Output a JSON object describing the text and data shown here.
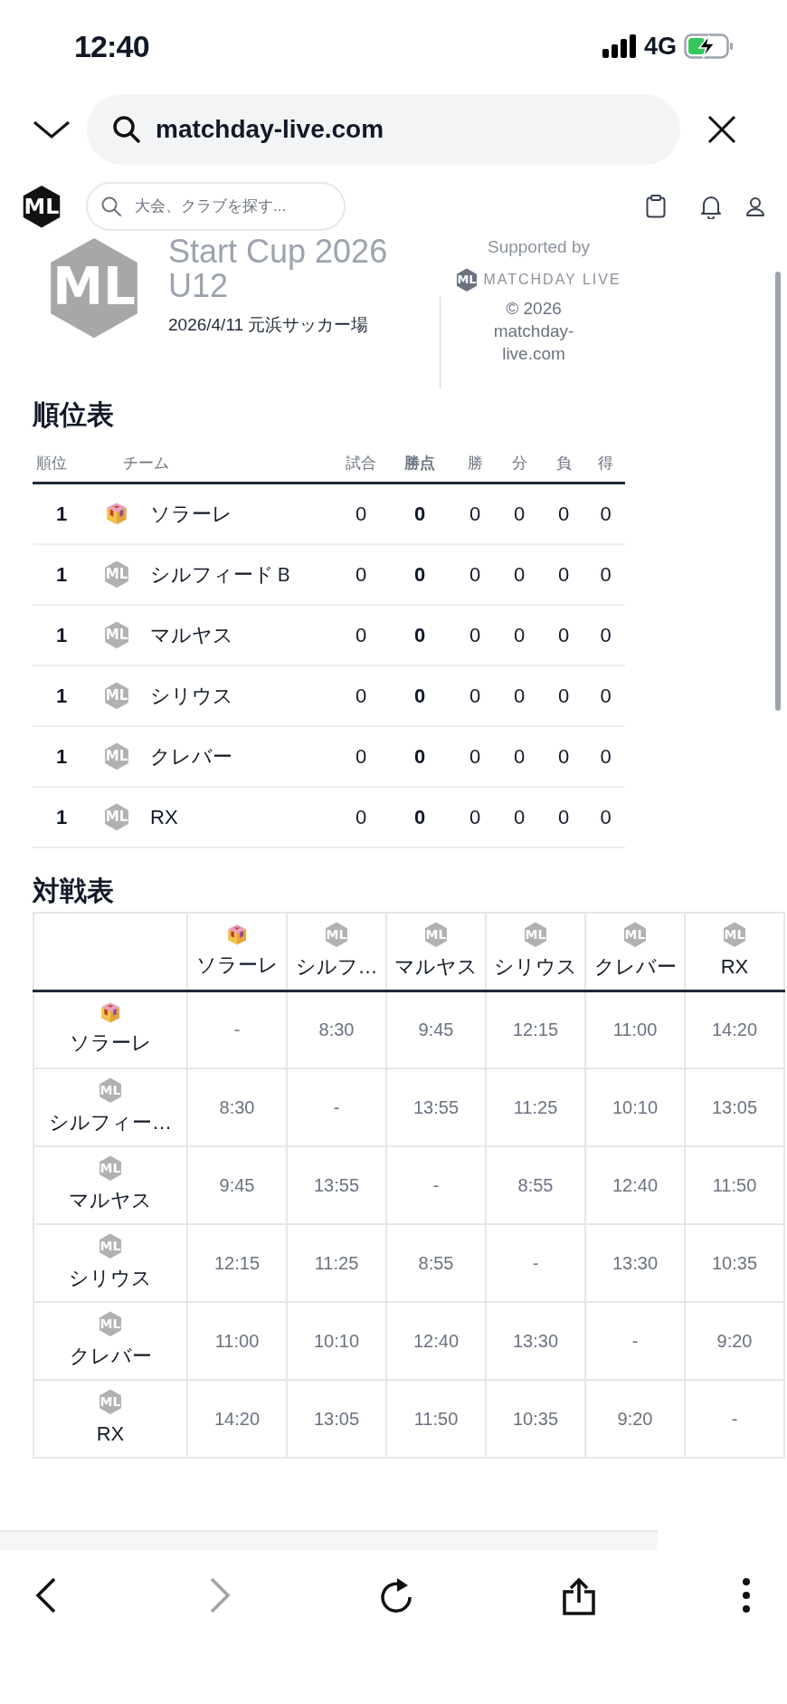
{
  "status_bar": {
    "time": "12:40",
    "network": "4G"
  },
  "browser": {
    "url": "matchday-live.com",
    "back": {
      "disabled": false
    },
    "forward": {
      "disabled": true
    }
  },
  "site_header": {
    "logo_text": "ML",
    "search_placeholder": "大会、クラブを探す..."
  },
  "tournament": {
    "logo_text": "ML",
    "title_lines": [
      "Start Cup 2026",
      "U12"
    ],
    "details": "2026/4/11 元浜サッカー場"
  },
  "sponsor": {
    "label": "Supported by",
    "brand": "MATCHDAY LIVE",
    "brand_logo_text": "ML",
    "copyright_lines": [
      "© 2026",
      "matchday-",
      "live.com"
    ]
  },
  "standings": {
    "title": "順位表",
    "columns": [
      {
        "label": "順位",
        "kind": "rank"
      },
      {
        "label": "チーム",
        "kind": "team"
      },
      {
        "label": "試合",
        "kind": "stat"
      },
      {
        "label": "勝点",
        "kind": "points"
      },
      {
        "label": "勝",
        "kind": "stat"
      },
      {
        "label": "分",
        "kind": "stat"
      },
      {
        "label": "負",
        "kind": "stat"
      },
      {
        "label": "得",
        "kind": "stat"
      }
    ],
    "rows": [
      {
        "rank": "1",
        "team": {
          "name": "ソラーレ",
          "crest": {
            "kind": "cube"
          }
        },
        "stats": [
          "0",
          "0",
          "0",
          "0",
          "0",
          "0"
        ]
      },
      {
        "rank": "1",
        "team": {
          "name": "シルフィードＢ",
          "crest": {
            "kind": "monogram",
            "text": "ML"
          }
        },
        "stats": [
          "0",
          "0",
          "0",
          "0",
          "0",
          "0"
        ]
      },
      {
        "rank": "1",
        "team": {
          "name": "マルヤス",
          "crest": {
            "kind": "monogram",
            "text": "ML"
          }
        },
        "stats": [
          "0",
          "0",
          "0",
          "0",
          "0",
          "0"
        ]
      },
      {
        "rank": "1",
        "team": {
          "name": "シリウス",
          "crest": {
            "kind": "monogram",
            "text": "ML"
          }
        },
        "stats": [
          "0",
          "0",
          "0",
          "0",
          "0",
          "0"
        ]
      },
      {
        "rank": "1",
        "team": {
          "name": "クレバー",
          "crest": {
            "kind": "monogram",
            "text": "ML"
          }
        },
        "stats": [
          "0",
          "0",
          "0",
          "0",
          "0",
          "0"
        ]
      },
      {
        "rank": "1",
        "team": {
          "name": "RX",
          "crest": {
            "kind": "monogram",
            "text": "ML"
          }
        },
        "stats": [
          "0",
          "0",
          "0",
          "0",
          "0",
          "0"
        ]
      }
    ]
  },
  "matrix": {
    "title": "対戦表",
    "columns": [
      {
        "name": "ソラーレ",
        "crest": {
          "kind": "cube"
        }
      },
      {
        "name": "シルフ…",
        "crest": {
          "kind": "monogram",
          "text": "ML"
        }
      },
      {
        "name": "マルヤス",
        "crest": {
          "kind": "monogram",
          "text": "ML"
        }
      },
      {
        "name": "シリウス",
        "crest": {
          "kind": "monogram",
          "text": "ML"
        }
      },
      {
        "name": "クレバー",
        "crest": {
          "kind": "monogram",
          "text": "ML"
        }
      },
      {
        "name": "RX",
        "crest": {
          "kind": "monogram",
          "text": "ML"
        }
      }
    ],
    "rows": [
      {
        "name": "ソラーレ",
        "crest": {
          "kind": "cube"
        },
        "cells": [
          "-",
          "8:30",
          "9:45",
          "12:15",
          "11:00",
          "14:20"
        ]
      },
      {
        "name": "シルフィー…",
        "crest": {
          "kind": "monogram",
          "text": "ML"
        },
        "cells": [
          "8:30",
          "-",
          "13:55",
          "11:25",
          "10:10",
          "13:05"
        ]
      },
      {
        "name": "マルヤス",
        "crest": {
          "kind": "monogram",
          "text": "ML"
        },
        "cells": [
          "9:45",
          "13:55",
          "-",
          "8:55",
          "12:40",
          "11:50"
        ]
      },
      {
        "name": "シリウス",
        "crest": {
          "kind": "monogram",
          "text": "ML"
        },
        "cells": [
          "12:15",
          "11:25",
          "8:55",
          "-",
          "13:30",
          "10:35"
        ]
      },
      {
        "name": "クレバー",
        "crest": {
          "kind": "monogram",
          "text": "ML"
        },
        "cells": [
          "11:00",
          "10:10",
          "12:40",
          "13:30",
          "-",
          "9:20"
        ]
      },
      {
        "name": "RX",
        "crest": {
          "kind": "monogram",
          "text": "ML"
        },
        "cells": [
          "14:20",
          "13:05",
          "11:50",
          "10:35",
          "9:20",
          "-"
        ]
      }
    ]
  }
}
